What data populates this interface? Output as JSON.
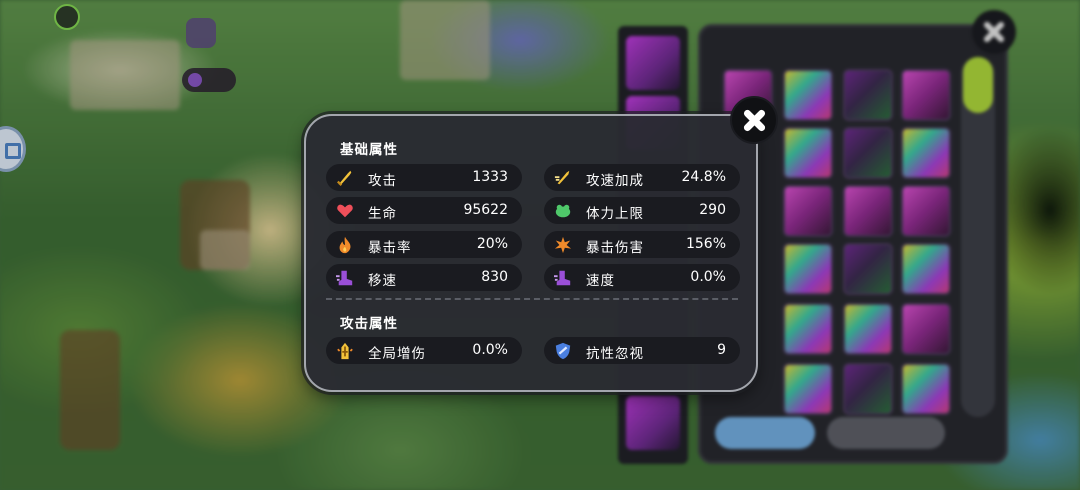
{
  "panel": {
    "basic_title": "基础属性",
    "attack_title": "攻击属性",
    "basic_stats": [
      {
        "label": "攻击",
        "value": "1333",
        "icon": "sword-icon",
        "color": "#f2c23a"
      },
      {
        "label": "攻速加成",
        "value": "24.8%",
        "icon": "swift-sword-icon",
        "color": "#f2c23a"
      },
      {
        "label": "生命",
        "value": "95622",
        "icon": "heart-icon",
        "color": "#ef4f5a"
      },
      {
        "label": "体力上限",
        "value": "290",
        "icon": "stamina-icon",
        "color": "#4fc86a"
      },
      {
        "label": "暴击率",
        "value": "20%",
        "icon": "crit-flame-icon",
        "color": "#f08a2a"
      },
      {
        "label": "暴击伤害",
        "value": "156%",
        "icon": "crit-burst-icon",
        "color": "#f08a2a"
      },
      {
        "label": "移速",
        "value": "830",
        "icon": "boot-icon",
        "color": "#9a4fd8"
      },
      {
        "label": "速度",
        "value": "0.0%",
        "icon": "speed-boot-icon",
        "color": "#9a4fd8"
      }
    ],
    "attack_stats": [
      {
        "label": "全局增伤",
        "value": "0.0%",
        "icon": "damage-boost-icon",
        "color": "#f2c23a"
      },
      {
        "label": "抗性忽视",
        "value": "9",
        "icon": "shield-break-icon",
        "color": "#4a7fe0"
      }
    ]
  }
}
